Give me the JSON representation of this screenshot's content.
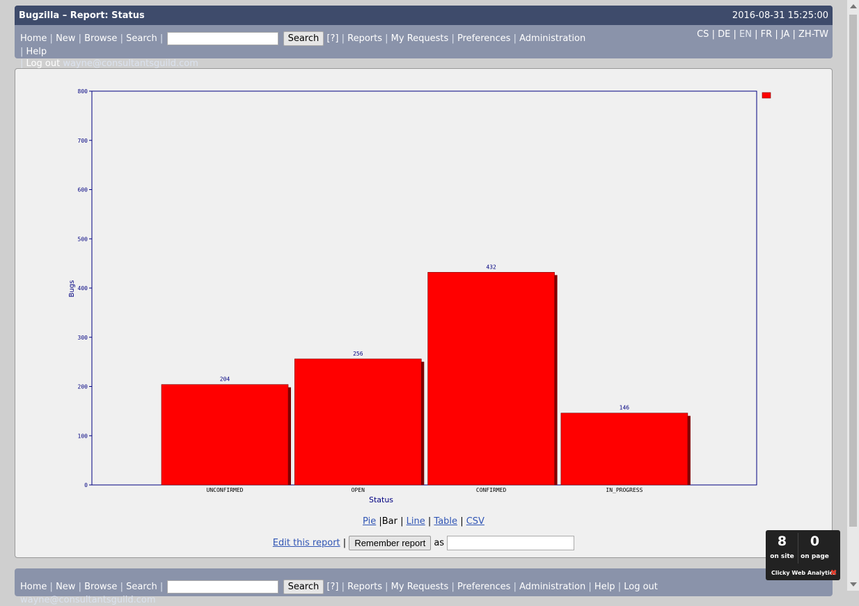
{
  "header": {
    "title": "Bugzilla – Report: Status",
    "datetime": "2016-08-31 15:25:00"
  },
  "nav": {
    "home": "Home",
    "new": "New",
    "browse": "Browse",
    "search": "Search",
    "search_button": "Search",
    "help_q": "[?]",
    "reports": "Reports",
    "my_requests": "My Requests",
    "preferences": "Preferences",
    "administration": "Administration",
    "help": "Help",
    "logout": "Log out",
    "user": "wayne@consultantsguild.com"
  },
  "languages": [
    "CS",
    "DE",
    "EN",
    "FR",
    "JA",
    "ZH-TW"
  ],
  "chart_data": {
    "type": "bar",
    "categories": [
      "UNCONFIRMED",
      "OPEN",
      "CONFIRMED",
      "IN_PROGRESS"
    ],
    "values": [
      204,
      256,
      432,
      146
    ],
    "xlabel": "Status",
    "ylabel": "Bugs",
    "ylim": [
      0,
      800
    ],
    "yticks": [
      0,
      100,
      200,
      300,
      400,
      500,
      600,
      700,
      800
    ],
    "bar_color": "#ff0000",
    "shadow_color": "#800000",
    "axis_color": "#000080",
    "legend": "top-right"
  },
  "formats": {
    "pie": "Pie",
    "bar": "Bar",
    "line": "Line",
    "table": "Table",
    "csv": "CSV"
  },
  "save": {
    "edit_link": "Edit this report",
    "remember_button": "Remember report",
    "as_label": "as"
  },
  "clicky": {
    "on_site_count": "8",
    "on_site_label": "on site",
    "on_page_count": "0",
    "on_page_label": "on page",
    "brand": "Clicky Web Analytics"
  }
}
